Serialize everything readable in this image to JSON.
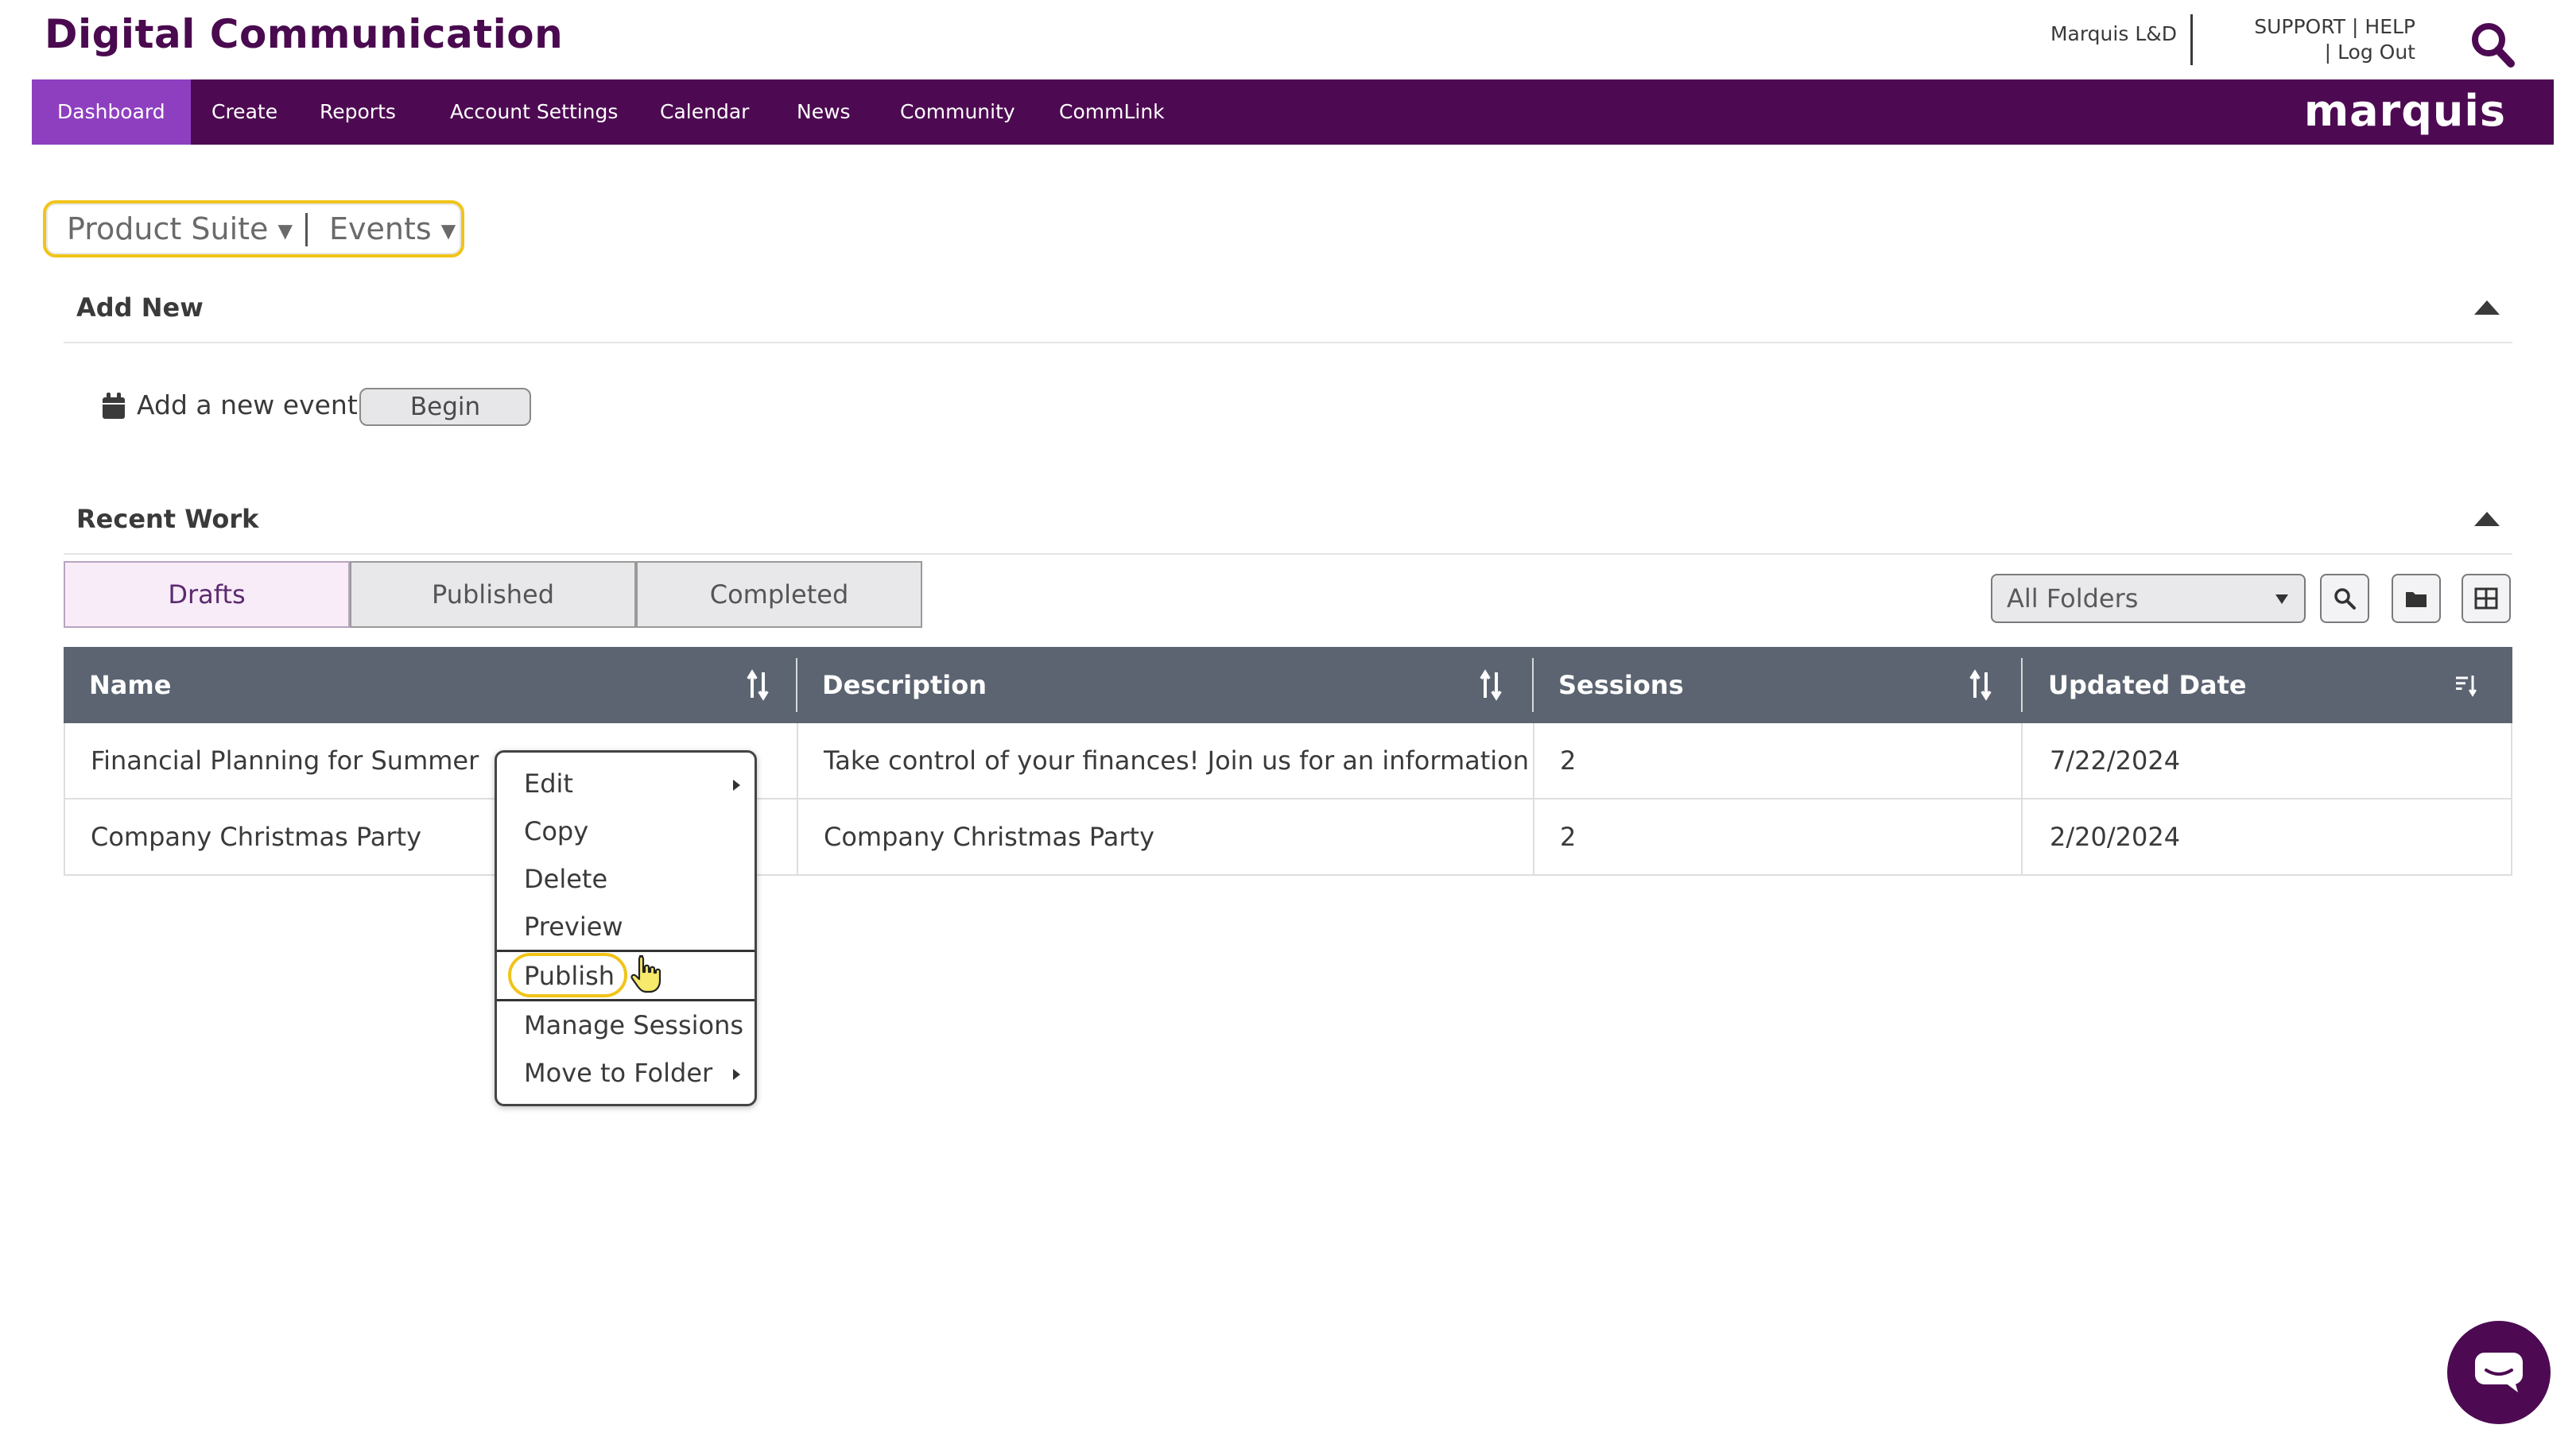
{
  "header": {
    "app_title": "Digital Communication",
    "org_name": "Marquis L&D",
    "support_link": "SUPPORT",
    "help_link": "HELP",
    "logout_link": "Log Out",
    "separator": "|",
    "brand": "marquis"
  },
  "nav": {
    "items": [
      {
        "label": "Dashboard",
        "active": true
      },
      {
        "label": "Create"
      },
      {
        "label": "Reports"
      },
      {
        "label": "Account Settings"
      },
      {
        "label": "Calendar"
      },
      {
        "label": "News"
      },
      {
        "label": "Community"
      },
      {
        "label": "CommLink"
      }
    ]
  },
  "context": {
    "product_suite": "Product Suite",
    "module": "Events"
  },
  "add_new": {
    "title": "Add New",
    "item_label": "Add a new event",
    "begin_label": "Begin"
  },
  "recent_work": {
    "title": "Recent Work",
    "tabs": [
      {
        "label": "Drafts",
        "active": true
      },
      {
        "label": "Published"
      },
      {
        "label": "Completed"
      }
    ],
    "folder_select": "All Folders"
  },
  "table": {
    "columns": [
      "Name",
      "Description",
      "Sessions",
      "Updated Date"
    ],
    "rows": [
      {
        "name": "Financial Planning for Summer",
        "description": "Take control of your finances! Join us for an information...",
        "sessions": "2",
        "updated": "7/22/2024"
      },
      {
        "name": "Company Christmas Party",
        "description": "Company Christmas Party",
        "sessions": "2",
        "updated": "2/20/2024"
      }
    ]
  },
  "context_menu": {
    "items": [
      "Edit",
      "Copy",
      "Delete",
      "Preview",
      "Publish",
      "Manage Sessions",
      "Move to Folder"
    ]
  },
  "colors": {
    "brand_purple": "#4d0a52",
    "nav_active": "#8e3fc0",
    "highlight": "#f0c419",
    "table_header": "#5b6470"
  }
}
